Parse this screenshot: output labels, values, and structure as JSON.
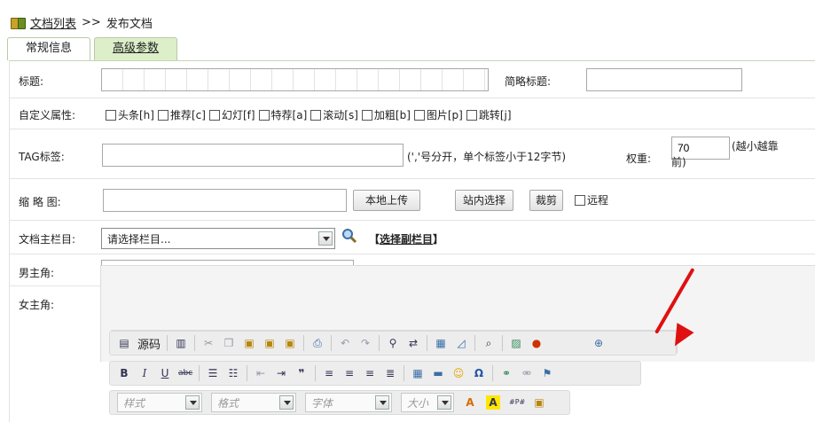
{
  "breadcrumb": {
    "link": "文档列表",
    "separator": ">>",
    "current": "发布文档"
  },
  "tabs": [
    {
      "label": "常规信息"
    },
    {
      "label": "高级参数"
    }
  ],
  "form": {
    "title": {
      "label": "标题:",
      "value": ""
    },
    "short_title": {
      "label": "简略标题:",
      "value": ""
    },
    "custom_attr": {
      "label": "自定义属性:",
      "options": [
        "头条[h]",
        "推荐[c]",
        "幻灯[f]",
        "特荐[a]",
        "滚动[s]",
        "加粗[b]",
        "图片[p]",
        "跳转[j]"
      ]
    },
    "tag": {
      "label": "TAG标签:",
      "value": "",
      "hint": "(','号分开，单个标签小于12字节)"
    },
    "weight": {
      "label": "权重:",
      "value": "70",
      "hint": "(越小越靠前)"
    },
    "thumbnail": {
      "label": "缩 略 图:",
      "value": "",
      "upload_button": "本地上传",
      "site_select_button": "站内选择",
      "crop_button": "裁剪",
      "remote_label": "远程"
    },
    "category": {
      "label": "文档主栏目:",
      "selected": "请选择栏目...",
      "sub_link": "选择副栏目",
      "sub_prefix": "【",
      "sub_suffix": "】"
    },
    "male_lead": {
      "label": "男主角:",
      "value": ""
    },
    "female_lead": {
      "label": "女主角:",
      "value": ""
    }
  },
  "editor": {
    "source_label": "源码",
    "style_combo": "样式",
    "format_combo": "格式",
    "font_combo": "字体",
    "size_combo": "大小"
  },
  "colors": {
    "annotation_arrow": "#e01010",
    "tab_active_bg": "#dcefc9"
  }
}
